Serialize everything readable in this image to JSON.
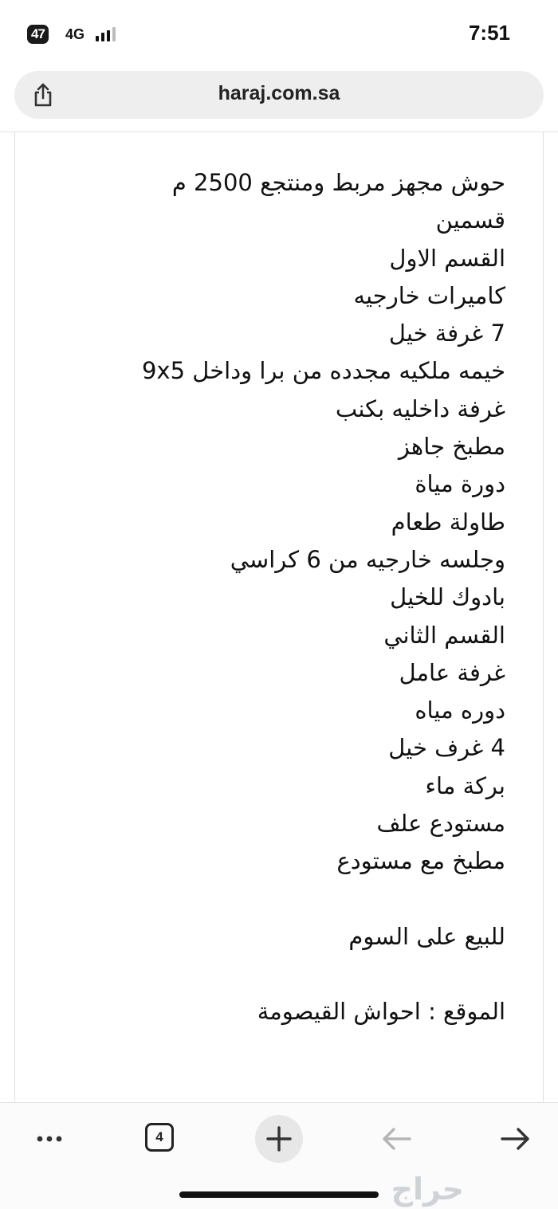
{
  "status_bar": {
    "badge": "47",
    "network": "4G",
    "time": "7:51"
  },
  "browser": {
    "url": "haraj.com.sa",
    "tab_count": "4"
  },
  "post": {
    "lines": [
      "حوش مجهز مربط ومنتجع 2500 م",
      "قسمين",
      "القسم الاول",
      "كاميرات خارجيه",
      "7 غرفة خيل",
      "خيمه ملكيه مجدده من برا وداخل 9x5",
      "غرفة داخليه بكنب",
      "مطبخ جاهز",
      "دورة مياة",
      "طاولة طعام",
      "وجلسه خارجيه من 6 كراسي",
      "بادوك للخيل",
      "القسم الثاني",
      "غرفة عامل",
      "دوره مياه",
      "4 غرف خيل",
      "بركة ماء",
      "مستودع علف",
      "مطبخ مع مستودع"
    ],
    "sale_note": "للبيع على السوم",
    "location": "الموقع : احواش القيصومة"
  },
  "watermark": "حراج",
  "icons": {
    "share": "share-icon",
    "more": "more-icon",
    "tabs": "tabs-icon",
    "new_tab": "plus-icon",
    "back": "back-arrow-icon",
    "forward": "forward-arrow-icon"
  }
}
